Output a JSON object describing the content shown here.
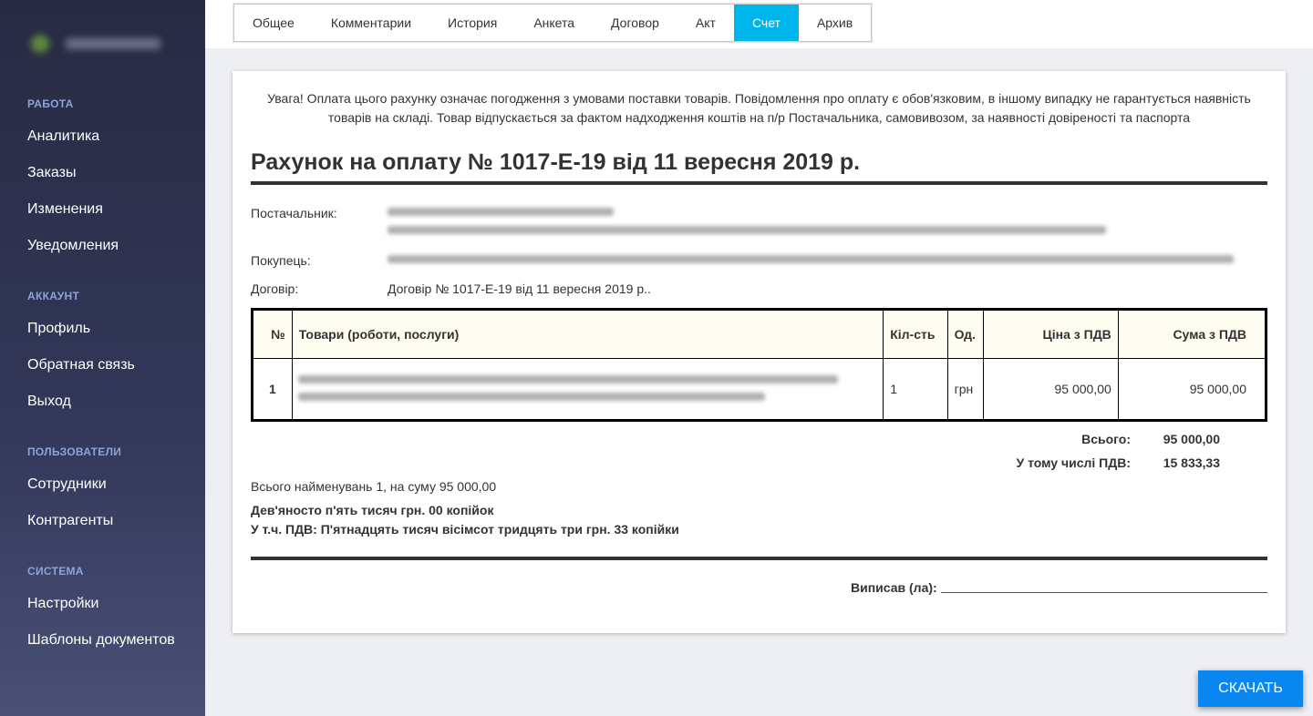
{
  "sidebar": {
    "sections": [
      {
        "title": "РАБОТА",
        "items": [
          "Аналитика",
          "Заказы",
          "Изменения",
          "Уведомления"
        ]
      },
      {
        "title": "АККАУНТ",
        "items": [
          "Профиль",
          "Обратная связь",
          "Выход"
        ]
      },
      {
        "title": "ПОЛЬЗОВАТЕЛИ",
        "items": [
          "Сотрудники",
          "Контрагенты"
        ]
      },
      {
        "title": "СИСТЕМА",
        "items": [
          "Настройки",
          "Шаблоны документов"
        ]
      }
    ]
  },
  "tabs": [
    "Общее",
    "Комментарии",
    "История",
    "Анкета",
    "Договор",
    "Акт",
    "Счет",
    "Архив"
  ],
  "active_tab": "Счет",
  "invoice": {
    "notice": "Увага! Оплата цього рахунку означає погодження з умовами поставки товарів. Повідомлення про оплату є обов'язковим, в іншому випадку не гарантується наявність товарів на складі. Товар відпускається за фактом надходження коштів на п/р Постачальника, самовивозом, за наявності довіреності та паспорта",
    "title": "Рахунок на оплату № 1017-Е-19 від 11 вересня 2019 р.",
    "supplier_label": "Постачальник:",
    "buyer_label": "Покупець:",
    "contract_label": "Договір:",
    "contract_value": "Договір № 1017-Е-19 від 11 вересня 2019 р..",
    "table": {
      "headers": [
        "№",
        "Товари (роботи, послуги)",
        "Кіл-сть",
        "Од.",
        "Ціна з ПДВ",
        "Сума з ПДВ"
      ],
      "rows": [
        {
          "no": "1",
          "qty": "1",
          "unit": "грн",
          "price": "95 000,00",
          "sum": "95 000,00"
        }
      ]
    },
    "total_label": "Всього:",
    "total_value": "95 000,00",
    "vat_label": "У тому числі ПДВ:",
    "vat_value": "15 833,33",
    "summary": "Всього найменувань 1, на суму 95 000,00",
    "amount_words": "Дев'яносто п'ять тисяч грн. 00 копійок",
    "vat_words": "У т.ч. ПДВ: П'ятнадцять тисяч вісімсот тридцять три грн. 33 копійки",
    "signed_label": "Виписав (ла):"
  },
  "download_label": "СКАЧАТЬ",
  "colors": {
    "active_tab": "#00b5ec",
    "download_button": "#0a86f0",
    "sidebar": "#2c3150",
    "section_title": "#8fa2d8"
  }
}
